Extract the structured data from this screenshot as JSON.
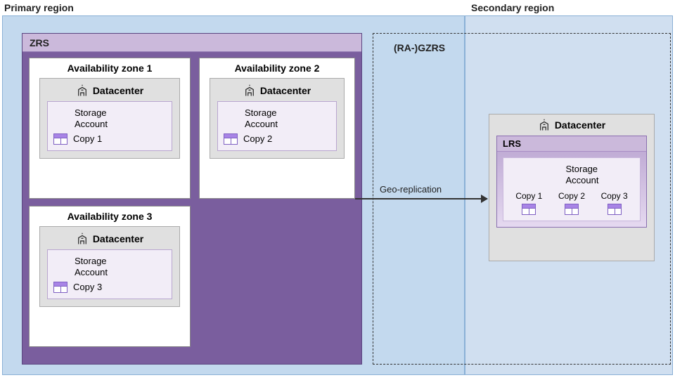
{
  "labels": {
    "primary": "Primary region",
    "secondary": "Secondary region",
    "gzrs": "(RA-)GZRS",
    "zrs": "ZRS",
    "lrs": "LRS",
    "datacenter": "Datacenter",
    "storage_account": "Storage\nAccount",
    "geo_replication": "Geo-replication"
  },
  "zones": {
    "z1": {
      "title": "Availability zone 1",
      "copy": "Copy 1"
    },
    "z2": {
      "title": "Availability zone 2",
      "copy": "Copy 2"
    },
    "z3": {
      "title": "Availability zone 3",
      "copy": "Copy 3"
    }
  },
  "secondary_copies": [
    "Copy 1",
    "Copy 2",
    "Copy 3"
  ]
}
